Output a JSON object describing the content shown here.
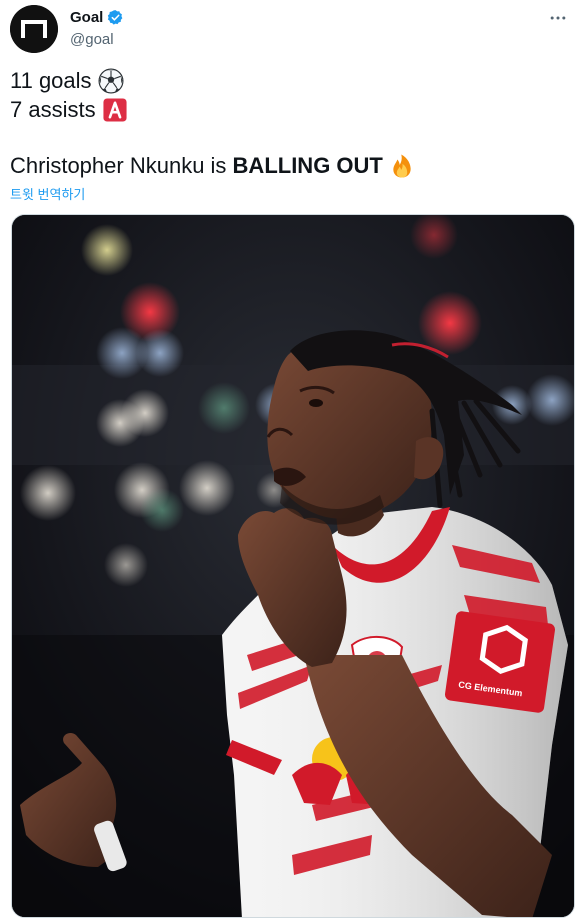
{
  "author": {
    "name": "Goal",
    "handle": "@goal",
    "verified": true
  },
  "tweet": {
    "lines": [
      {
        "text": "11 goals",
        "emoji": "soccer-ball-icon"
      },
      {
        "text": "7 assists",
        "emoji": "letter-a-badge-icon"
      }
    ],
    "headline_prefix": "Christopher Nkunku is ",
    "headline_bold": "BALLING OUT",
    "headline_emoji": "fire-icon"
  },
  "translate_label": "트윗 번역하기",
  "media": {
    "jersey_sponsor": "CG Elementum"
  },
  "colors": {
    "link": "#1d9bf0",
    "verified": "#1d9bf0",
    "text": "#0f1419",
    "muted": "#536471",
    "kit_red": "#d11a2a"
  }
}
